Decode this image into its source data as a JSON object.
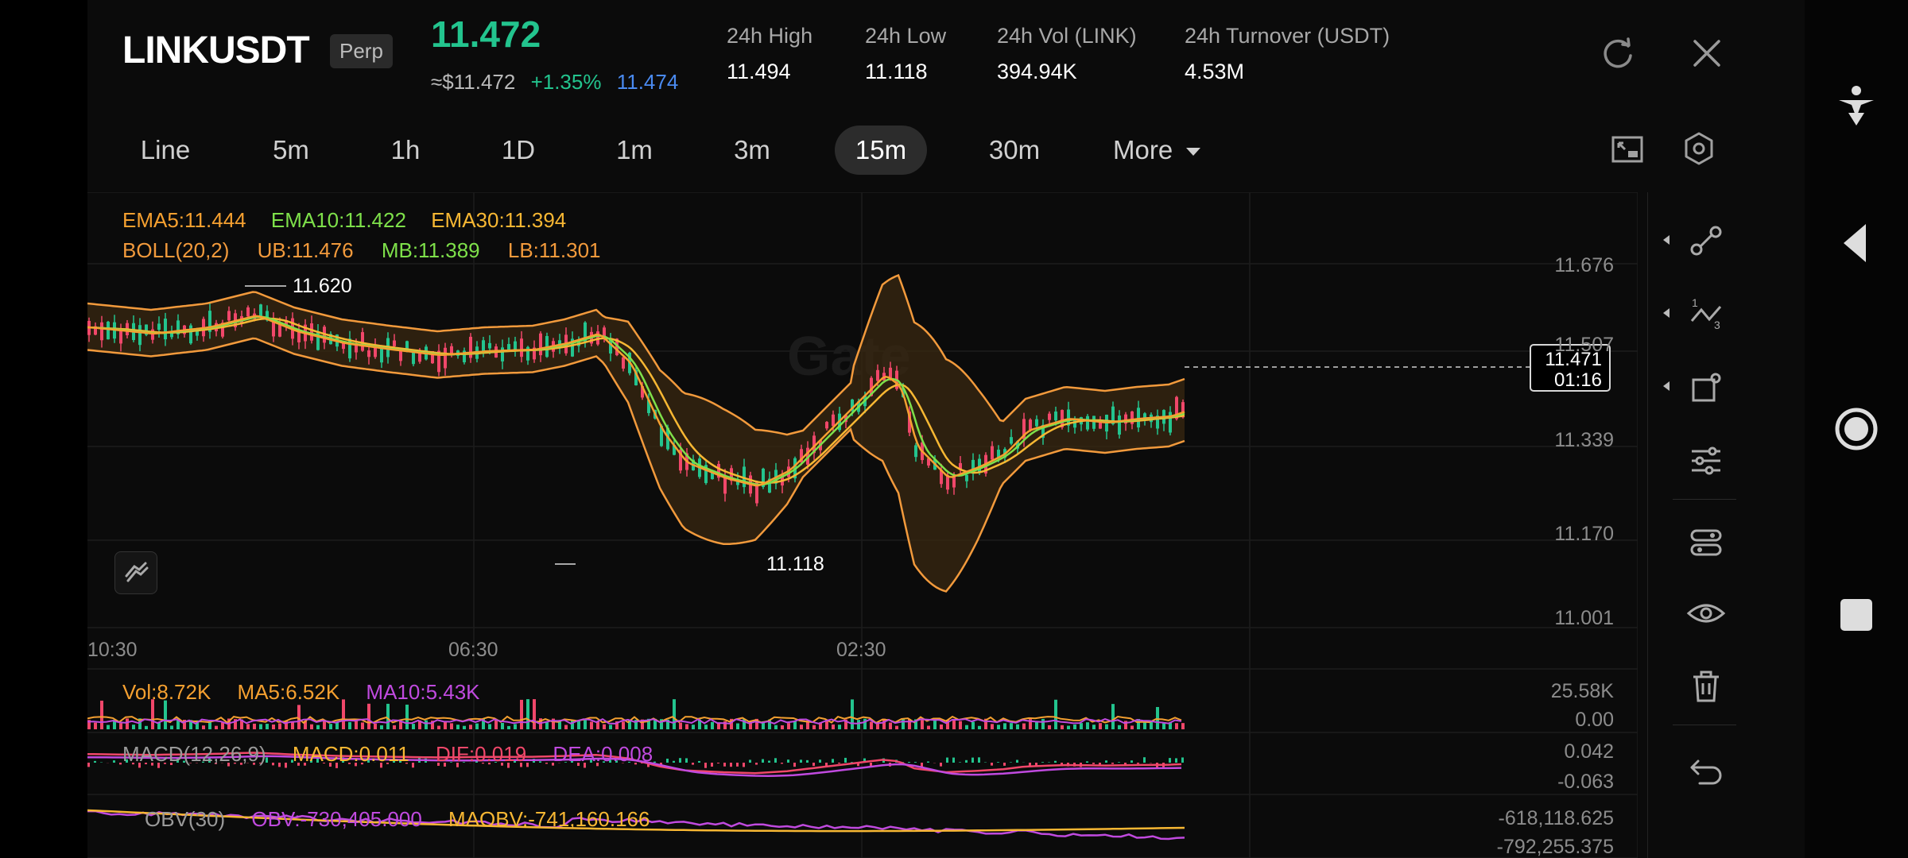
{
  "header": {
    "symbol": "LINKUSDT",
    "badge": "Perp",
    "last_price": "11.472",
    "fiat_price": "≈$11.472",
    "change": "+1.35%",
    "mark_price": "11.474",
    "stats": [
      {
        "label": "24h High",
        "value": "11.494"
      },
      {
        "label": "24h Low",
        "value": "11.118"
      },
      {
        "label": "24h Vol (LINK)",
        "value": "394.94K"
      },
      {
        "label": "24h Turnover (USDT)",
        "value": "4.53M"
      }
    ]
  },
  "timeframes": [
    "Line",
    "5m",
    "1h",
    "1D",
    "1m",
    "3m",
    "15m",
    "30m",
    "More"
  ],
  "active_timeframe": "15m",
  "main_legend": {
    "ema5": "EMA5:11.444",
    "ema10": "EMA10:11.422",
    "ema30": "EMA30:11.394",
    "boll": "BOLL(20,2)",
    "ub": "UB:11.476",
    "mb": "MB:11.389",
    "lb": "LB:11.301"
  },
  "annotations": {
    "high": "11.620",
    "low": "11.118"
  },
  "price_axis": [
    "11.676",
    "11.507",
    "11.339",
    "11.170",
    "11.001"
  ],
  "current_price_tag": {
    "price": "11.471",
    "countdown": "01:16"
  },
  "time_axis": [
    "10:30",
    "06:30",
    "02:30"
  ],
  "watermark": "Gate",
  "volume": {
    "vol": "Vol:8.72K",
    "ma5": "MA5:6.52K",
    "ma10": "MA10:5.43K",
    "axis_top": "25.58K",
    "axis_bottom": "0.00"
  },
  "macd": {
    "name": "MACD(12,26,9)",
    "macd": "MACD:0.011",
    "dif": "DIF:0.019",
    "dea": "DEA:0.008",
    "axis_top": "0.042",
    "axis_bottom": "-0.063"
  },
  "obv": {
    "name": "OBV(30)",
    "obv": "OBV:-730,405.000",
    "maobv": "MAOBV:-741,160.166",
    "axis_top": "-618,118.625",
    "axis_bottom": "-792,255.375"
  },
  "colors": {
    "up": "#23c48e",
    "down": "#f0476a",
    "ema5": "#f5a030",
    "ema10": "#7ee04a",
    "ema30": "#f7b733",
    "boll": "#f29a3c",
    "mb": "#7ee04a",
    "macd_dea": "#c04adf",
    "mark": "#4a8af0"
  },
  "sidebar_icons": [
    "line-tool-icon",
    "fib-tool-icon",
    "shape-tool-icon",
    "indicator-settings-icon",
    "toggle-settings-icon",
    "visibility-icon",
    "delete-icon",
    "undo-icon"
  ],
  "nav_icons": [
    "accessibility-icon",
    "back-icon",
    "home-icon",
    "recents-icon"
  ]
}
